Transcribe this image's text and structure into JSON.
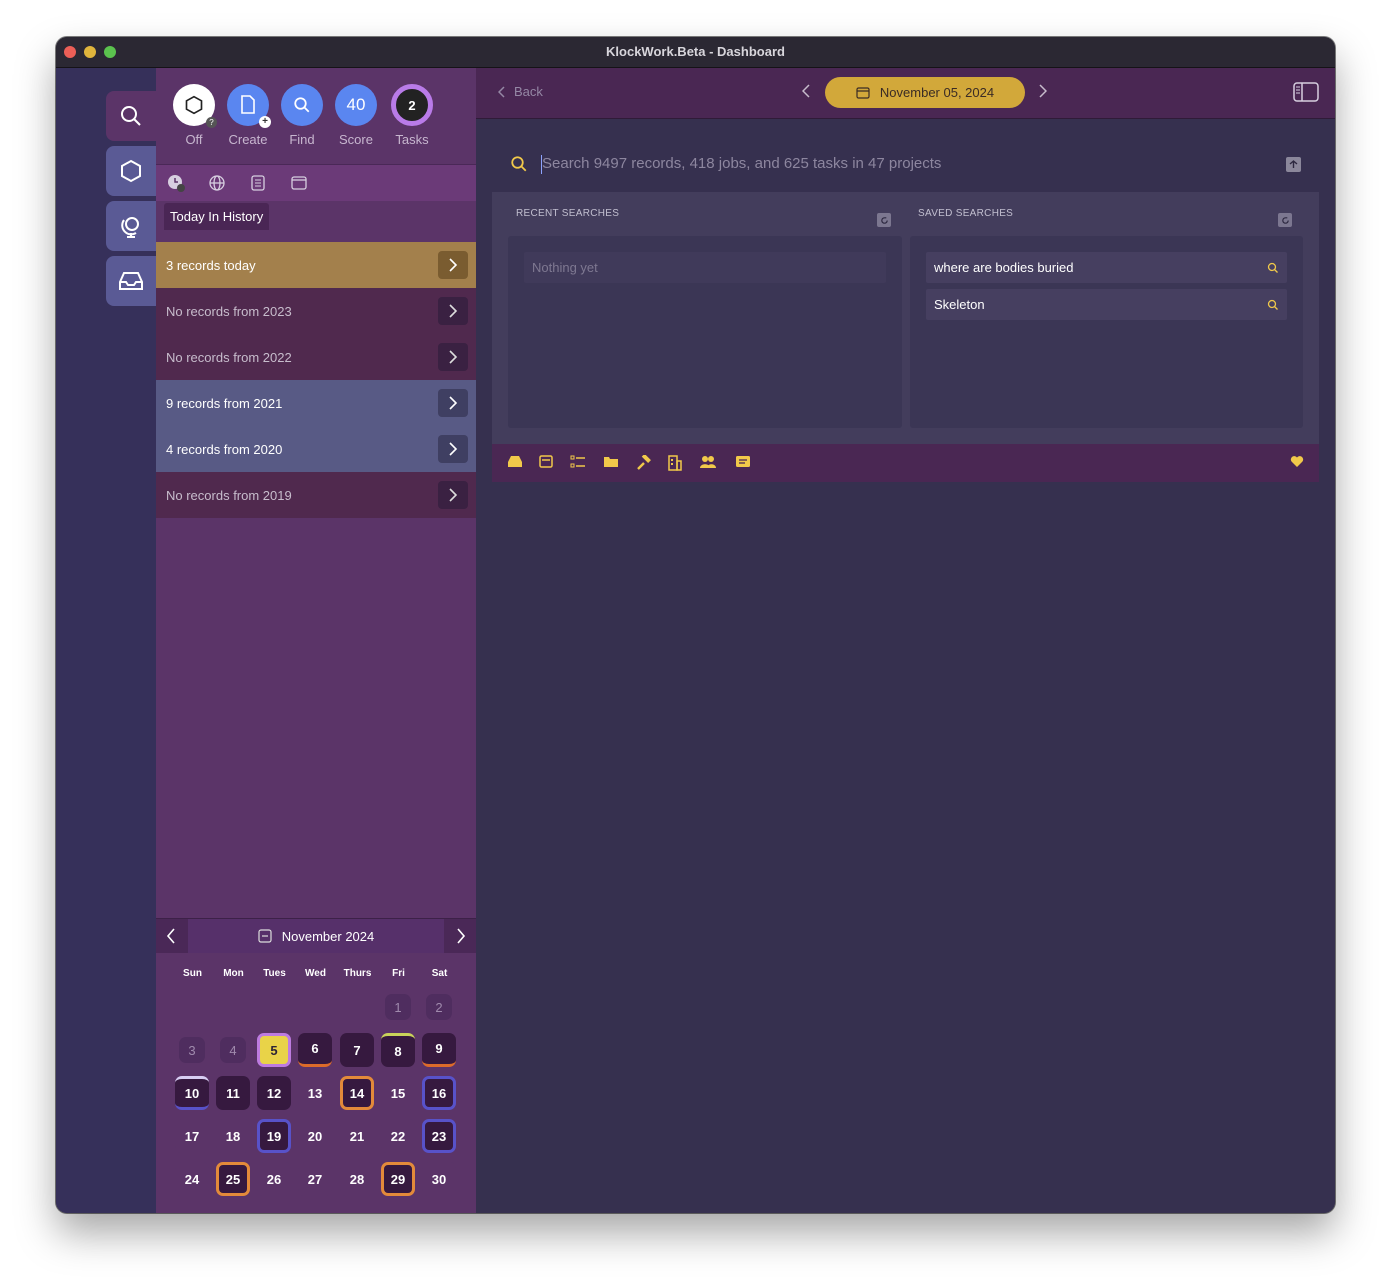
{
  "window": {
    "title": "KlockWork.Beta - Dashboard"
  },
  "top_icons": [
    {
      "label": "Off",
      "icon": "hexagon-icon"
    },
    {
      "label": "Create",
      "icon": "document-plus-icon"
    },
    {
      "label": "Find",
      "icon": "search-icon"
    },
    {
      "label": "Score",
      "value": "40"
    },
    {
      "label": "Tasks",
      "value": "2"
    }
  ],
  "history": {
    "tab_label": "Today In History",
    "rows": [
      {
        "label": "3 records today"
      },
      {
        "label": "No records from 2023"
      },
      {
        "label": "No records from 2022"
      },
      {
        "label": "9 records from 2021"
      },
      {
        "label": "4 records from 2020"
      },
      {
        "label": "No records from 2019"
      }
    ]
  },
  "calendar": {
    "month_label": "November 2024",
    "weekdays": [
      "Sun",
      "Mon",
      "Tues",
      "Wed",
      "Thurs",
      "Fri",
      "Sat"
    ],
    "days": [
      "1",
      "2",
      "3",
      "4",
      "5",
      "6",
      "7",
      "8",
      "9",
      "10",
      "11",
      "12",
      "13",
      "14",
      "15",
      "16",
      "17",
      "18",
      "19",
      "20",
      "21",
      "22",
      "23",
      "24",
      "25",
      "26",
      "27",
      "28",
      "29",
      "30"
    ]
  },
  "header": {
    "back_label": "Back",
    "date_label": "November 05, 2024"
  },
  "search": {
    "placeholder": "Search 9497 records, 418 jobs, and 625 tasks in 47 projects",
    "recent_title": "RECENT SEARCHES",
    "recent_empty": "Nothing yet",
    "saved_title": "SAVED SEARCHES",
    "saved": [
      "where are bodies buried",
      "Skeleton"
    ]
  },
  "colors": {
    "accent_gold": "#d2a83a",
    "sidebar_purple": "#5b3468",
    "main_bg": "#36304f",
    "icon_yellow": "#f1c94a"
  }
}
